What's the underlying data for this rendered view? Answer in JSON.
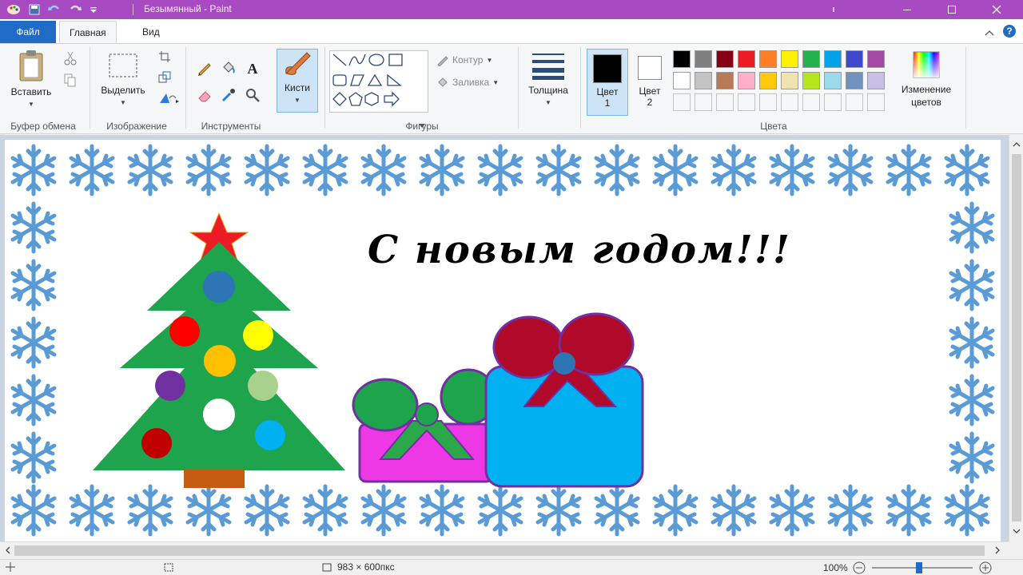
{
  "titlebar": {
    "title": "Безымянный - Paint",
    "bg_color": "#a84ac2"
  },
  "menu": {
    "file": "Файл",
    "tabs": [
      "Главная",
      "Вид"
    ]
  },
  "ribbon": {
    "clipboard": {
      "paste": "Вставить",
      "group": "Буфер обмена"
    },
    "image": {
      "select": "Выделить",
      "group": "Изображение"
    },
    "tools": {
      "group": "Инструменты",
      "brushes": "Кисти"
    },
    "shapes": {
      "outline": "Контур",
      "fill": "Заливка",
      "group": "Фигуры"
    },
    "thickness": "Толщина",
    "colors": {
      "color1": "Цвет 1",
      "color2": "Цвет 2",
      "edit": "Изменение цветов",
      "group": "Цвета",
      "palette_row1": [
        "#000000",
        "#7f7f7f",
        "#880015",
        "#ed1c24",
        "#ff7f27",
        "#fff200",
        "#22b14c",
        "#00a2e8",
        "#3f48cc",
        "#a349a4"
      ],
      "palette_row2": [
        "#ffffff",
        "#c3c3c3",
        "#b97a57",
        "#ffaec9",
        "#ffc90e",
        "#efe4b0",
        "#b5e61d",
        "#99d9ea",
        "#7092be",
        "#c8bfe7"
      ]
    }
  },
  "canvas": {
    "greeting": "С новым годом!!!",
    "snowflake_color": "#5b9bd5"
  },
  "statusbar": {
    "size": "983 × 600пкс",
    "zoom": "100%"
  }
}
